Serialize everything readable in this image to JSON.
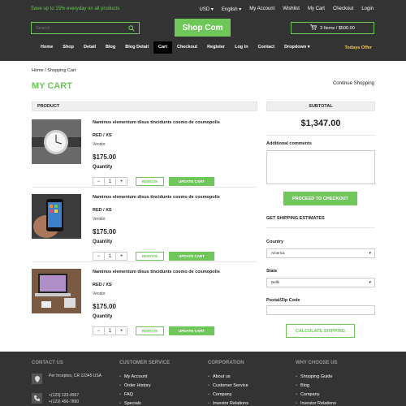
{
  "topbar": {
    "promo": "Save up to 15% everyday on all products",
    "links": [
      "USD ▾",
      "English ▾",
      "My Account",
      "Wishlist",
      "My Cart",
      "Checkout",
      "Login"
    ]
  },
  "search": {
    "placeholder": "Search"
  },
  "logo": "Shop Com",
  "cart": {
    "summary": "3 Items / $500.00"
  },
  "nav": {
    "items": [
      "Home",
      "Shop",
      "Detail",
      "Blog",
      "Blog Detail",
      "Cart",
      "Checkout",
      "Register",
      "Log In",
      "Contact",
      "Dropdown ▾"
    ],
    "active": "Cart",
    "offer": "Todays Offer"
  },
  "breadcrumb": "Home / Shopping Cart",
  "page_title": "MY CART",
  "continue_link": "Continue Shopping",
  "table": {
    "product_header": "PRODUCT",
    "subtotal_header": "SUBTOTAL"
  },
  "products": [
    {
      "name": "Naminos elementum disus tincidunts cosmo de cosmopolis",
      "variant": "RED / XS",
      "vendor": "Vendor",
      "price": "$175.00",
      "qty_label": "Quantity",
      "qty": "1",
      "image": "watch"
    },
    {
      "name": "Naminos elementum disus tincidunts cosmo de cosmopolis",
      "variant": "RED / XS",
      "vendor": "Vendor",
      "price": "$175.00",
      "qty_label": "Quantity",
      "qty": "1",
      "image": "phone"
    },
    {
      "name": "Naminos elementum disus tincidunts cosmo de cosmopolis",
      "variant": "RED / XS",
      "vendor": "Vendor",
      "price": "$175.00",
      "qty_label": "Quantity",
      "qty": "1",
      "image": "laptop"
    }
  ],
  "buttons": {
    "remove": "REMOVE",
    "update": "UPDATE CART",
    "minus": "−",
    "plus": "+"
  },
  "summary": {
    "subtotal": "$1,347.00",
    "comments_label": "Additional comments",
    "checkout": "PROCEED TO CHECKOUT",
    "shipping_title": "GET SHIPPING ESTIMATES",
    "country_label": "Country",
    "country_value": "America",
    "state_label": "State",
    "state_value": "Delhi",
    "zip_label": "Postal/Zip Code",
    "calculate": "CALCULATE SHIPPING"
  },
  "footer": {
    "contact": {
      "title": "CONTACT US",
      "address": "Per Inceptos, CR 12345 USA",
      "phone1": "+(123) 123-4567",
      "phone2": "+(123) 456-7890"
    },
    "columns": [
      {
        "title": "CUSTOMER SERVICE",
        "items": [
          "My Account",
          "Order History",
          "FAQ",
          "Specials"
        ]
      },
      {
        "title": "CORPORATION",
        "items": [
          "About us",
          "Customer Service",
          "Company",
          "Investor Relations"
        ]
      },
      {
        "title": "WHY CHOOSE US",
        "items": [
          "Shopping Guide",
          "Blog",
          "Company",
          "Investor Relations"
        ]
      }
    ]
  },
  "colors": {
    "accent": "#6fc75a",
    "dark": "#333333",
    "offer": "#f2c94c"
  }
}
